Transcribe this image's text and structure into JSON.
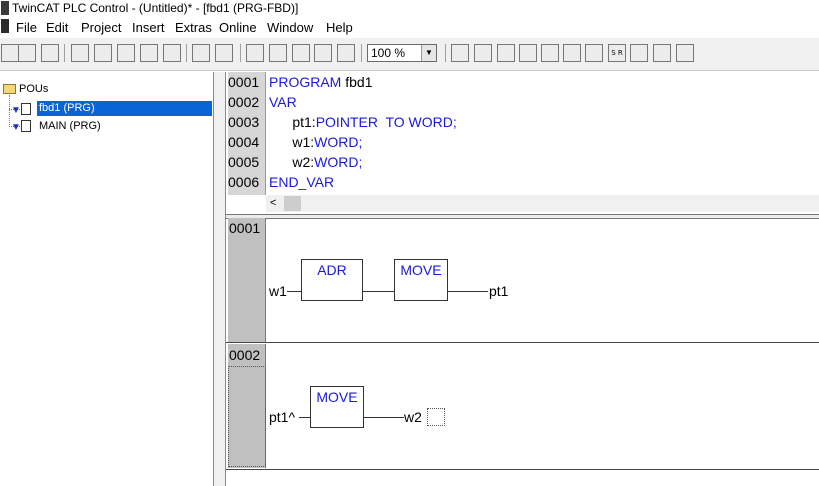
{
  "window": {
    "title": "TwinCAT PLC Control - (Untitled)* - [fbd1 (PRG-FBD)]"
  },
  "menu": {
    "items": [
      "File",
      "Edit",
      "Project",
      "Insert",
      "Extras",
      "Online",
      "Window",
      "Help"
    ]
  },
  "toolbar": {
    "zoom_value": "100 %",
    "buttons": [
      {
        "name": "new-icon",
        "glyph": ""
      },
      {
        "name": "open-icon",
        "glyph": ""
      },
      {
        "name": "save-icon",
        "glyph": ""
      },
      {
        "name": "login-icon",
        "glyph": ""
      },
      {
        "name": "stop-icon",
        "glyph": ""
      },
      {
        "name": "run-icon",
        "glyph": ""
      },
      {
        "name": "logout-icon",
        "glyph": ""
      },
      {
        "name": "download-icon",
        "glyph": ""
      },
      {
        "name": "cut-icon",
        "glyph": ""
      },
      {
        "name": "copy-icon",
        "glyph": ""
      },
      {
        "name": "cut-icon-2",
        "glyph": ""
      },
      {
        "name": "copy-icon-2",
        "glyph": ""
      },
      {
        "name": "paste-icon",
        "glyph": ""
      },
      {
        "name": "find-icon",
        "glyph": ""
      },
      {
        "name": "replace-icon",
        "glyph": ""
      },
      {
        "name": "network-icon",
        "glyph": ""
      },
      {
        "name": "assign-icon",
        "glyph": ""
      },
      {
        "name": "box-icon",
        "glyph": ""
      },
      {
        "name": "jump-icon",
        "glyph": ""
      },
      {
        "name": "return-icon",
        "glyph": ""
      },
      {
        "name": "contact-icon",
        "glyph": ""
      },
      {
        "name": "coil-icon",
        "glyph": ""
      },
      {
        "name": "parallel-contact-icon",
        "glyph": "S R"
      },
      {
        "name": "set-reset-icon",
        "glyph": ""
      },
      {
        "name": "negate-icon",
        "glyph": ""
      },
      {
        "name": "edge-icon",
        "glyph": ""
      }
    ]
  },
  "tree": {
    "root_label": "POUs",
    "items": [
      {
        "label": "fbd1 (PRG)",
        "selected": true
      },
      {
        "label": "MAIN (PRG)",
        "selected": false
      }
    ]
  },
  "declaration": {
    "lines": [
      {
        "num": "0001",
        "keyword": "PROGRAM",
        "rest": " fbd1"
      },
      {
        "num": "0002",
        "keyword": "VAR",
        "rest": ""
      },
      {
        "num": "0003",
        "pre": "      pt1:",
        "keyword": "POINTER  TO WORD;"
      },
      {
        "num": "0004",
        "pre": "      w1:",
        "keyword": "WORD;"
      },
      {
        "num": "0005",
        "pre": "      w2:",
        "keyword": "WORD;"
      },
      {
        "num": "0006",
        "keyword": "END_VAR",
        "rest": ""
      }
    ],
    "scroll_left": "<"
  },
  "networks": [
    {
      "num": "0001",
      "input": "w1",
      "blocks": [
        "ADR",
        "MOVE"
      ],
      "output": "pt1"
    },
    {
      "num": "0002",
      "input": "pt1^",
      "blocks": [
        "MOVE"
      ],
      "output": "w2"
    }
  ]
}
